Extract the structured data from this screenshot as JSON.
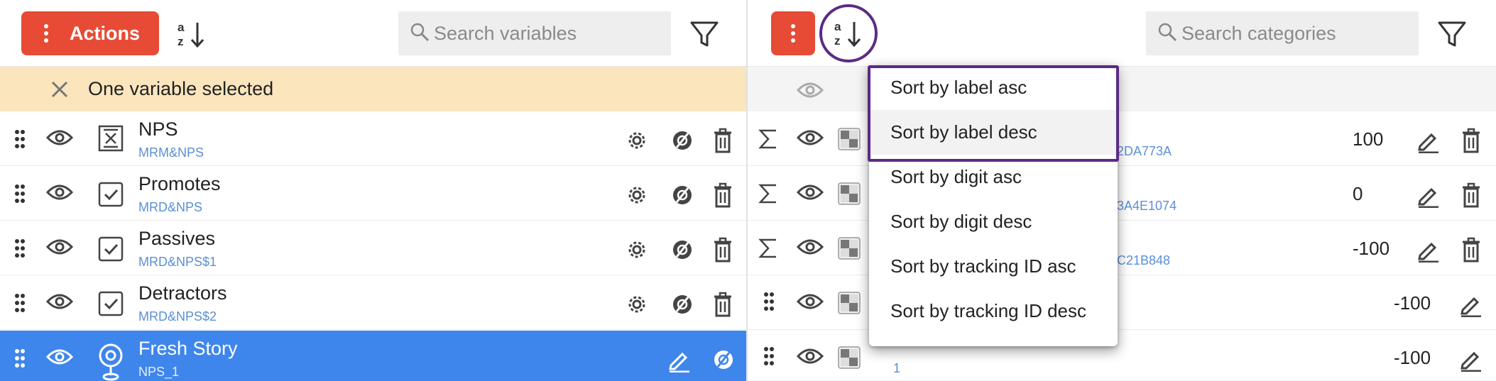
{
  "left": {
    "actions_label": "Actions",
    "search_placeholder": "Search variables",
    "selection_banner": "One variable selected",
    "rows": [
      {
        "name": "NPS",
        "sub": "MRM&NPS",
        "type_icon": "formula-box-icon"
      },
      {
        "name": "Promotes",
        "sub": "MRD&NPS",
        "type_icon": "checkbox-icon"
      },
      {
        "name": "Passives",
        "sub": "MRD&NPS$1",
        "type_icon": "checkbox-icon"
      },
      {
        "name": "Detractors",
        "sub": "MRD&NPS$2",
        "type_icon": "checkbox-icon"
      },
      {
        "name": "Fresh Story",
        "sub": "NPS_1",
        "type_icon": "location-pin-icon"
      }
    ]
  },
  "right": {
    "search_placeholder": "Search categories",
    "rows": [
      {
        "code": "2DA773A",
        "value": "100"
      },
      {
        "code": "3A4E1074",
        "value": "0"
      },
      {
        "code": "C21B848",
        "value": "-100"
      },
      {
        "code": "",
        "value": "-100"
      },
      {
        "code": "1",
        "value": "-100"
      }
    ]
  },
  "sort_menu": {
    "items": [
      "Sort by label asc",
      "Sort by label desc",
      "Sort by digit asc",
      "Sort by digit desc",
      "Sort by tracking ID asc",
      "Sort by tracking ID desc"
    ]
  },
  "colors": {
    "accent_red": "#e84b35",
    "selection_blue": "#3f86ec",
    "banner_bg": "#fbe5bd",
    "highlight_purple": "#5b2a86"
  }
}
